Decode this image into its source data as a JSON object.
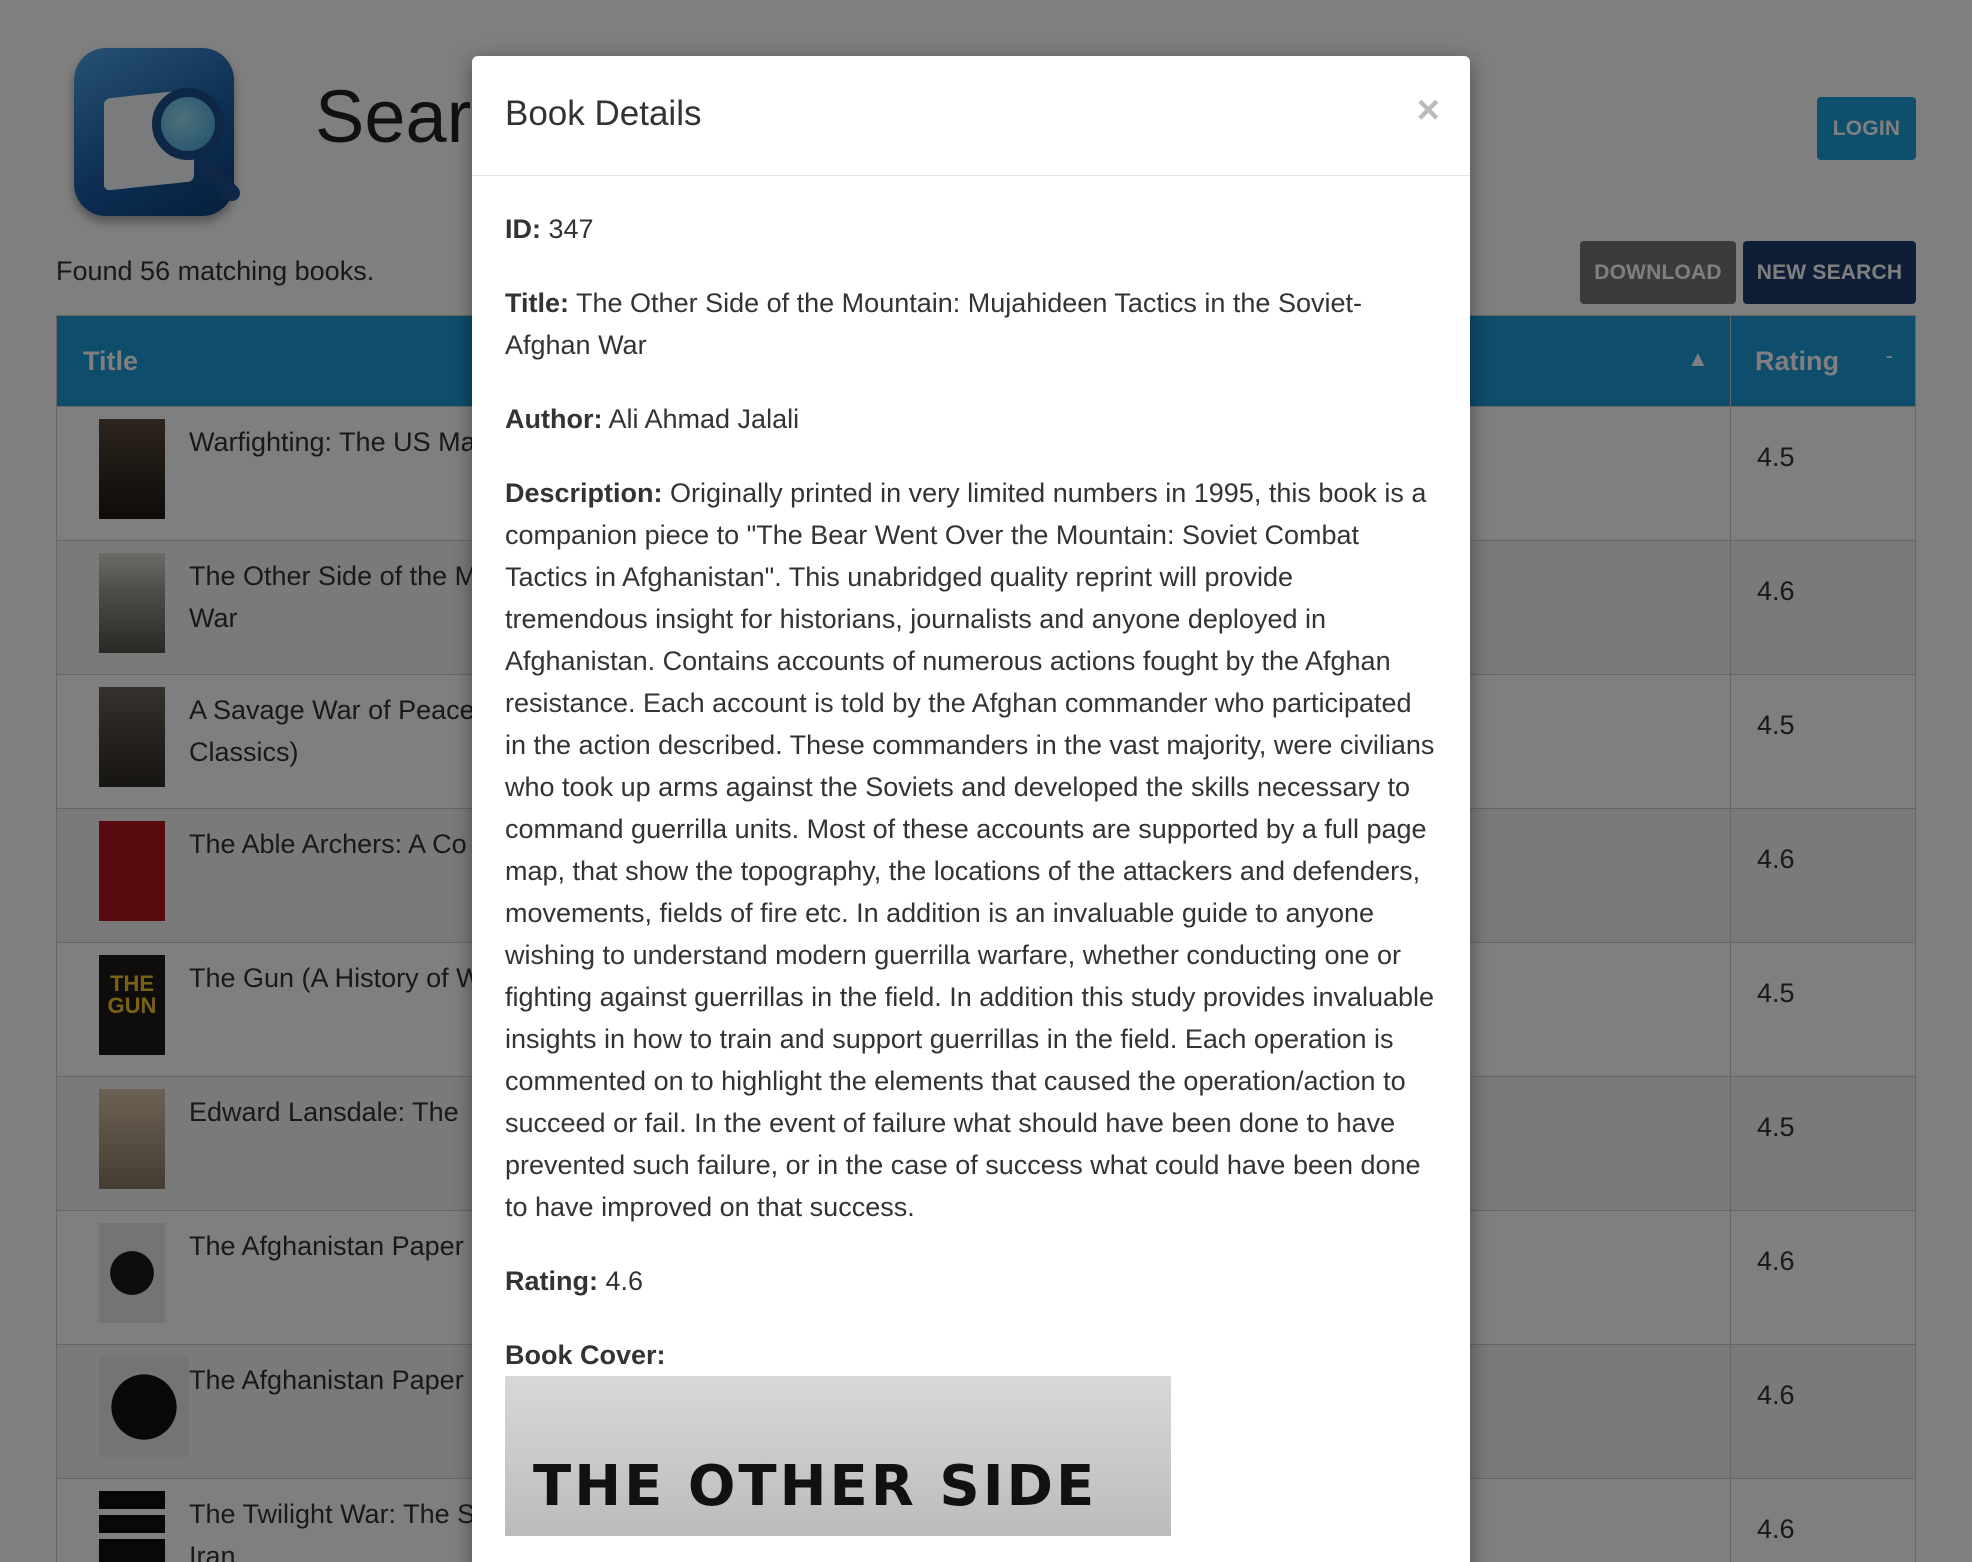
{
  "header": {
    "title": "Searc",
    "login_label": "LOGIN"
  },
  "results": {
    "found_text": "Found 56 matching books.",
    "download_label": "DOWNLOAD",
    "new_search_label": "NEW SEARCH"
  },
  "table": {
    "col_title": "Title",
    "col_title_sort": "▲",
    "col_rating": "Rating",
    "col_rating_sort": "-",
    "rows": [
      {
        "title": "Warfighting: The US Ma",
        "rating": "4.5"
      },
      {
        "title": "The Other Side of the M\nWar",
        "rating": "4.6"
      },
      {
        "title": "A Savage War of Peace\nClassics)",
        "rating": "4.5"
      },
      {
        "title": "The Able Archers: A Co",
        "rating": "4.6"
      },
      {
        "title": "The Gun (A History of W",
        "rating": "4.5"
      },
      {
        "title": "Edward Lansdale: The",
        "rating": "4.5"
      },
      {
        "title": "The Afghanistan Paper",
        "rating": "4.6"
      },
      {
        "title": "The Afghanistan Paper",
        "rating": "4.6"
      },
      {
        "title": "The Twilight War: The S\nIran",
        "rating": "4.6"
      }
    ],
    "gun_cover_text": "THE\nGUN"
  },
  "modal": {
    "title": "Book Details",
    "close_glyph": "×",
    "id_label": "ID:",
    "id_value": "347",
    "title_label": "Title:",
    "title_value": "The Other Side of the Mountain: Mujahideen Tactics in the Soviet-Afghan War",
    "author_label": "Author:",
    "author_value": "Ali Ahmad Jalali",
    "description_label": "Description:",
    "description_value": "Originally printed in very limited numbers in 1995, this book is a companion piece to \"The Bear Went Over the Mountain: Soviet Combat Tactics in Afghanistan\". This unabridged quality reprint will provide tremendous insight for historians, journalists and anyone deployed in Afghanistan. Contains accounts of numerous actions fought by the Afghan resistance. Each account is told by the Afghan commander who participated in the action described. These commanders in the vast majority, were civilians who took up arms against the Soviets and developed the skills necessary to command guerrilla units. Most of these accounts are supported by a full page map, that show the topography, the locations of the attackers and defenders, movements, fields of fire etc. In addition is an invaluable guide to anyone wishing to understand modern guerrilla warfare, whether conducting one or fighting against guerrillas in the field. In addition this study provides invaluable insights in how to train and support guerrillas in the field. Each operation is commented on to highlight the elements that caused the operation/action to succeed or fail. In the event of failure what should have been done to have prevented such failure, or in the case of success what could have been done to have improved on that success.",
    "rating_label": "Rating:",
    "rating_value": "4.6",
    "cover_label": "Book Cover:",
    "cover_text": "THE OTHER SIDE"
  },
  "colors": {
    "header_blue": "#1c9ad6",
    "login_blue": "#1a9fd9",
    "download_gray": "#777777",
    "new_search_navy": "#1f3d6e"
  },
  "icons": {
    "logo": "search-magnifier-logo-icon",
    "sort": "sort-ascending-icon",
    "close": "close-icon"
  }
}
